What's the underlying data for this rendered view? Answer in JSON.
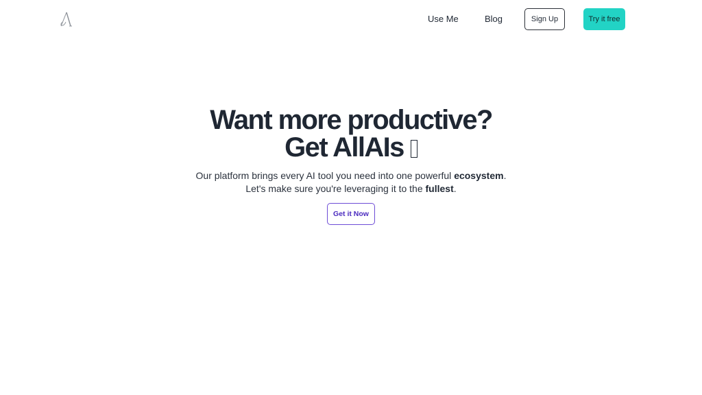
{
  "header": {
    "logo_icon": "calligraphic-a-logo",
    "nav": [
      {
        "label": "Use Me"
      },
      {
        "label": "Blog"
      }
    ],
    "signup_label": "Sign Up",
    "try_label": "Try it free"
  },
  "hero": {
    "title_line1": "Want more productive?",
    "title_line2": "Get AllAIs",
    "title_glyph": "missing-glyph-box",
    "sub_line1_a": "Our platform brings every AI tool you need into one powerful ",
    "sub_line1_bold": "ecosystem",
    "sub_line1_end": ".",
    "sub_line2_a": "Let's make sure you're leveraging it to the ",
    "sub_line2_bold": "fullest",
    "sub_line2_end": ".",
    "cta_label": "Get it Now"
  },
  "colors": {
    "accent_teal": "#22d3c5",
    "accent_purple": "#6d4bd6",
    "text_dark": "#1f2733"
  }
}
